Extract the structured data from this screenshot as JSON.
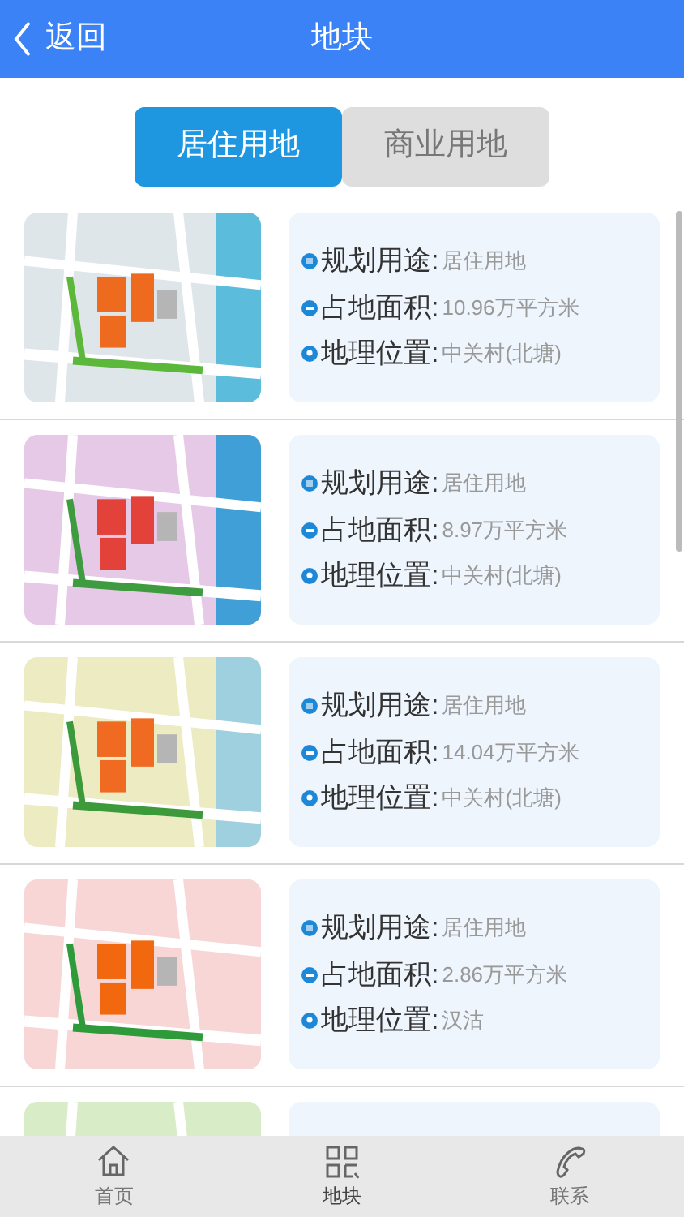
{
  "header": {
    "back": "返回",
    "title": "地块"
  },
  "tabs": [
    {
      "label": "居住用地",
      "selected": true
    },
    {
      "label": "商业用地",
      "selected": false
    }
  ],
  "lots": [
    {
      "fields": [
        {
          "kind": "use",
          "label": "规划用途:",
          "value": "居住用地"
        },
        {
          "kind": "area",
          "label": "占地面积:",
          "value": "10.96万平方米"
        },
        {
          "kind": "location",
          "label": "地理位置:",
          "value": "中关村(北塘)"
        }
      ]
    },
    {
      "fields": [
        {
          "kind": "use",
          "label": "规划用途:",
          "value": "居住用地"
        },
        {
          "kind": "area",
          "label": "占地面积:",
          "value": "8.97万平方米"
        },
        {
          "kind": "location",
          "label": "地理位置:",
          "value": "中关村(北塘)"
        }
      ]
    },
    {
      "fields": [
        {
          "kind": "use",
          "label": "规划用途:",
          "value": "居住用地"
        },
        {
          "kind": "area",
          "label": "占地面积:",
          "value": "14.04万平方米"
        },
        {
          "kind": "location",
          "label": "地理位置:",
          "value": "中关村(北塘)"
        }
      ]
    },
    {
      "fields": [
        {
          "kind": "use",
          "label": "规划用途:",
          "value": "居住用地"
        },
        {
          "kind": "area",
          "label": "占地面积:",
          "value": "2.86万平方米"
        },
        {
          "kind": "location",
          "label": "地理位置:",
          "value": "汉沽"
        }
      ]
    },
    {
      "kind": "picture"
    }
  ],
  "nav": [
    {
      "kind": "home",
      "label": "首页",
      "selected": false
    },
    {
      "kind": "grid",
      "label": "地块",
      "selected": true
    },
    {
      "kind": "phone",
      "label": "联系",
      "selected": false
    }
  ]
}
